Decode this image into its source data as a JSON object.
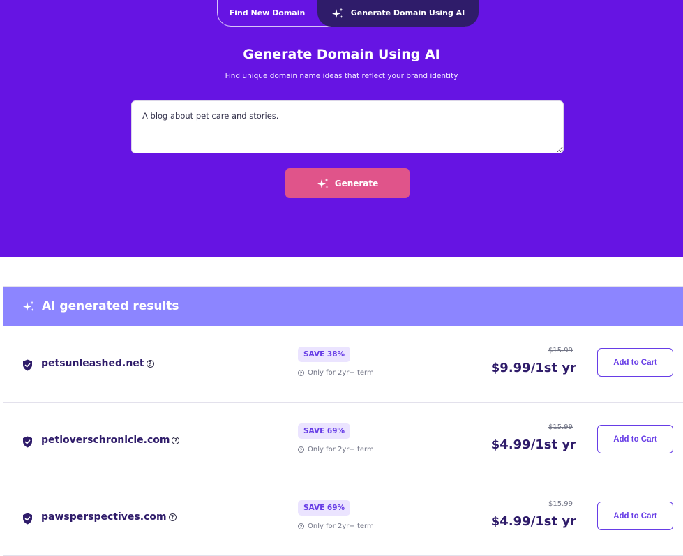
{
  "toggle": {
    "find_label": "Find New Domain",
    "ai_label": "Generate Domain Using AI"
  },
  "hero": {
    "title": "Generate Domain Using AI",
    "subtitle": "Find unique domain name ideas that reflect your brand identity",
    "prompt_value": "A blog about pet care and stories.",
    "generate_label": "Generate"
  },
  "results": {
    "header": "AI generated results",
    "items": [
      {
        "domain": "petsunleashed.net",
        "save": "SAVE 38%",
        "term": "Only for 2yr+ term",
        "old_price": "$15.99",
        "price": "$9.99/1st yr",
        "cart_label": "Add to Cart"
      },
      {
        "domain": "petloverschronicle.com",
        "save": "SAVE 69%",
        "term": "Only for 2yr+ term",
        "old_price": "$15.99",
        "price": "$4.99/1st yr",
        "cart_label": "Add to Cart"
      },
      {
        "domain": "pawsperspectives.com",
        "save": "SAVE 69%",
        "term": "Only for 2yr+ term",
        "old_price": "$15.99",
        "price": "$4.99/1st yr",
        "cart_label": "Add to Cart"
      }
    ]
  },
  "colors": {
    "hero_bg": "#6614e3",
    "active_tab": "#2f1c6a",
    "generate_button": "#e0548a",
    "results_header": "#8c85ff",
    "accent": "#673de6"
  },
  "icons": {
    "sparkle": "sparkle-icon",
    "shield": "shield-check-icon",
    "help": "help-circle-icon"
  }
}
